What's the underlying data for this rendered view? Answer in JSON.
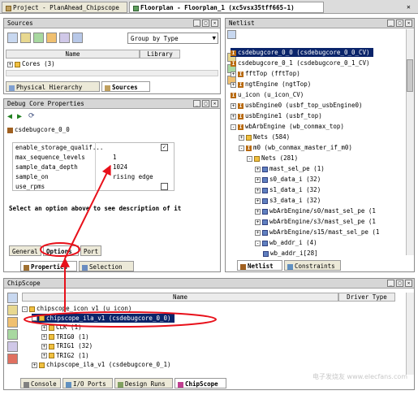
{
  "top_tabs": [
    {
      "label": "Project - PlanAhead_Chipscope"
    },
    {
      "label": "Floorplan - Floorplan_1 (xc5vsx35tff665-1)"
    }
  ],
  "sources": {
    "title": "Sources",
    "dropdown": "Group by Type",
    "columns": [
      "Name",
      "Library"
    ],
    "row": "Cores (3)",
    "tabs": [
      "Physical Hierarchy",
      "Sources"
    ]
  },
  "debug": {
    "title": "Debug Core Properties",
    "core": "csdebugcore_0_0",
    "props": [
      {
        "name": "enable_storage_qualif...",
        "value": ""
      },
      {
        "name": "max_sequence_levels",
        "value": "1"
      },
      {
        "name": "sample_data_depth",
        "value": "1024"
      },
      {
        "name": "sample_on",
        "value": "rising edge"
      },
      {
        "name": "use_rpms",
        "value": ""
      }
    ],
    "help": "Select an option above to see description of it",
    "subtabs": [
      "General",
      "Options",
      "Port"
    ],
    "bottom_tabs": [
      "Properties",
      "Selection"
    ]
  },
  "netlist": {
    "title": "Netlist",
    "rows": [
      {
        "text": "csdebugcore_0_0 (csdebugcore_0_0_CV)",
        "indent": 0,
        "kind": "u",
        "sel": true
      },
      {
        "text": "csdebugcore_0_1 (csdebugcore_0_1_CV)",
        "indent": 0,
        "kind": "u"
      },
      {
        "text": "fftTop (fftTop)",
        "indent": 0,
        "kind": "u",
        "exp": "+"
      },
      {
        "text": "ngtEngine (ngtTop)",
        "indent": 0,
        "kind": "u",
        "exp": "+"
      },
      {
        "text": "u_icon (u_icon_CV)",
        "indent": 0,
        "kind": "u"
      },
      {
        "text": "usbEngine0 (usbf_top_usbEngine0)",
        "indent": 0,
        "kind": "u",
        "exp": "+"
      },
      {
        "text": "usbEngine1 (usbf_top)",
        "indent": 0,
        "kind": "u",
        "exp": "+"
      },
      {
        "text": "wbArbEngine (wb_conmax_top)",
        "indent": 0,
        "kind": "u",
        "exp": "-"
      },
      {
        "text": "Nets (584)",
        "indent": 1,
        "kind": "folder",
        "exp": "+"
      },
      {
        "text": "m0 (wb_conmax_master_if_m0)",
        "indent": 1,
        "kind": "u",
        "exp": "-"
      },
      {
        "text": "Nets (281)",
        "indent": 2,
        "kind": "folder",
        "exp": "-"
      },
      {
        "text": "mast_sel_pe (1)",
        "indent": 3,
        "kind": "port",
        "exp": "+"
      },
      {
        "text": "s0_data_i (32)",
        "indent": 3,
        "kind": "port",
        "exp": "+"
      },
      {
        "text": "s1_data_i (32)",
        "indent": 3,
        "kind": "port",
        "exp": "+"
      },
      {
        "text": "s3_data_i (32)",
        "indent": 3,
        "kind": "port",
        "exp": "+"
      },
      {
        "text": "wbArbEngine/s0/mast_sel_pe (1",
        "indent": 3,
        "kind": "port",
        "exp": "+"
      },
      {
        "text": "wbArbEngine/s3/mast_sel_pe (1",
        "indent": 3,
        "kind": "port",
        "exp": "+"
      },
      {
        "text": "wbArbEngine/s15/mast_sel_pe (1",
        "indent": 3,
        "kind": "port",
        "exp": "+"
      },
      {
        "text": "wb_addr_i (4)",
        "indent": 3,
        "kind": "port",
        "exp": "-"
      },
      {
        "text": "wb_addr_i[28]",
        "indent": 4,
        "kind": "port"
      }
    ],
    "bottom_tabs": [
      "Netlist",
      "Constraints"
    ]
  },
  "chipscope": {
    "title": "ChipScope",
    "columns": [
      "Name",
      "Driver Type"
    ],
    "rows": [
      {
        "text": "chipscope_icon_v1 (u_icon)",
        "indent": 0,
        "exp": "-"
      },
      {
        "text": "chipscope_ila_v1 (csdebugcore_0_0)",
        "indent": 1,
        "exp": "-",
        "sel": true
      },
      {
        "text": "CLK (1)",
        "indent": 2,
        "exp": "+"
      },
      {
        "text": "TRIG0 (1)",
        "indent": 2,
        "exp": "+"
      },
      {
        "text": "TRIG1 (32)",
        "indent": 2,
        "exp": "+"
      },
      {
        "text": "TRIG2 (1)",
        "indent": 2,
        "exp": "+"
      },
      {
        "text": "chipscope_ila_v1 (csdebugcore_0_1)",
        "indent": 1,
        "exp": "+"
      }
    ],
    "bottom_tabs": [
      "Console",
      "I/O Ports",
      "Design Runs",
      "ChipScope"
    ]
  },
  "watermark": "电子发烧友 www.elecfans.com",
  "colors": {
    "annotation": "#e8101a",
    "selection": "#0a246a"
  }
}
